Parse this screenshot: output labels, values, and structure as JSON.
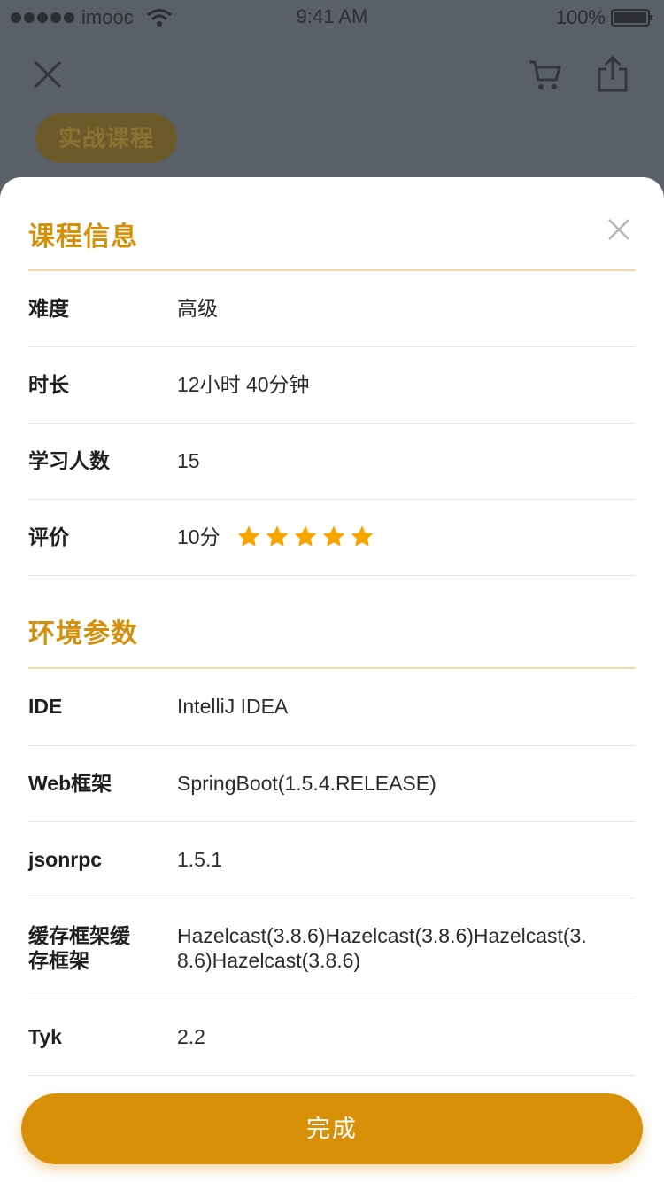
{
  "status_bar": {
    "carrier": "imooc",
    "time": "9:41 AM",
    "battery": "100%"
  },
  "background": {
    "course_tag": "实战课程"
  },
  "course_info": {
    "title": "课程信息",
    "rows": [
      {
        "label": "难度",
        "value": "高级"
      },
      {
        "label": "时长",
        "value": "12小时 40分钟"
      },
      {
        "label": "学习人数",
        "value": "15"
      },
      {
        "label": "评价",
        "value": "10分"
      }
    ],
    "rating_stars": 5,
    "star_color": "#f7a600"
  },
  "environment": {
    "title": "环境参数",
    "rows": [
      {
        "label": "IDE",
        "value": "IntelliJ IDEA"
      },
      {
        "label": "Web框架",
        "value": "SpringBoot(1.5.4.RELEASE)"
      },
      {
        "label": "jsonrpc",
        "value": "1.5.1"
      },
      {
        "label_line1": "缓存框架缓",
        "label_line2": "存框架",
        "value_line1": "Hazelcast(3.8.6)Hazelcast(3.8.6)Hazelcast(3.",
        "value_line2": "8.6)Hazelcast(3.8.6)"
      },
      {
        "label": "Tyk",
        "value": "2.2"
      }
    ]
  },
  "actions": {
    "done_label": "完成"
  },
  "colors": {
    "accent": "#d89009",
    "title": "#d4900b"
  }
}
